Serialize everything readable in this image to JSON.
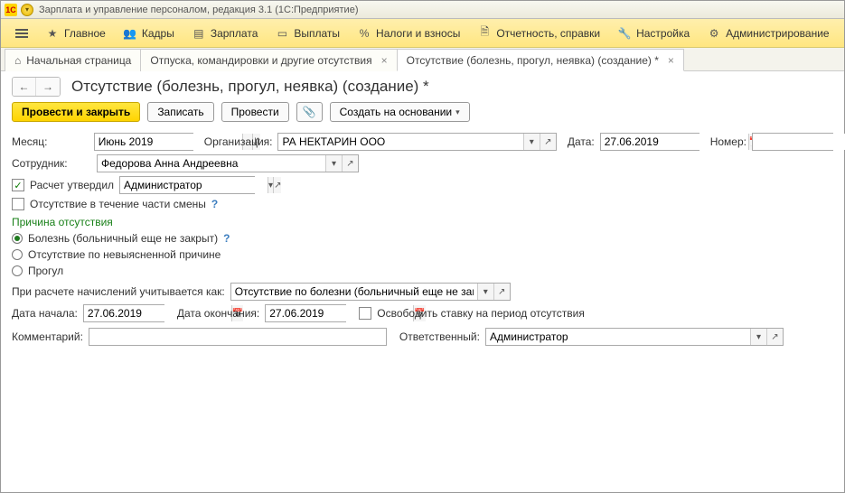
{
  "titlebar": {
    "logo_text": "1С",
    "title": "Зарплата и управление персоналом, редакция 3.1  (1С:Предприятие)"
  },
  "menu": {
    "main": "Главное",
    "staff": "Кадры",
    "salary": "Зарплата",
    "payments": "Выплаты",
    "taxes": "Налоги и взносы",
    "reports": "Отчетность, справки",
    "settings": "Настройка",
    "admin": "Администрирование"
  },
  "tabs": {
    "home": "Начальная страница",
    "t1": "Отпуска, командировки и другие отсутствия",
    "t2": "Отсутствие (болезнь, прогул, неявка) (создание) *"
  },
  "page": {
    "title": "Отсутствие (болезнь, прогул, неявка) (создание) *"
  },
  "actions": {
    "post_close": "Провести и закрыть",
    "save": "Записать",
    "post": "Провести",
    "create_based": "Создать на основании"
  },
  "form": {
    "month_lbl": "Месяц:",
    "month_val": "Июнь 2019",
    "org_lbl": "Организация:",
    "org_val": "РА НЕКТАРИН ООО",
    "date_lbl": "Дата:",
    "date_val": "27.06.2019",
    "number_lbl": "Номер:",
    "number_val": "",
    "employee_lbl": "Сотрудник:",
    "employee_val": "Федорова Анна Андреевна",
    "approved_lbl": "Расчет утвердил",
    "approved_val": "Администратор",
    "partial_lbl": "Отсутствие в течение части смены",
    "reason_section": "Причина отсутствия",
    "r1": "Болезнь (больничный еще не закрыт)",
    "r2": "Отсутствие по невыясненной причине",
    "r3": "Прогул",
    "calc_lbl": "При расчете начислений учитывается как:",
    "calc_val": "Отсутствие по болезни (больничный еще не закрыт)",
    "start_lbl": "Дата начала:",
    "start_val": "27.06.2019",
    "end_lbl": "Дата окончания:",
    "end_val": "27.06.2019",
    "release_lbl": "Освободить ставку на период отсутствия",
    "comment_lbl": "Комментарий:",
    "comment_val": "",
    "resp_lbl": "Ответственный:",
    "resp_val": "Администратор"
  },
  "glyph": {
    "question": "?",
    "check": "✓",
    "dots": "⋯",
    "cal": "📅",
    "open": "↗",
    "dd": "▾",
    "left": "←",
    "right": "→",
    "updown": "⇵",
    "clip": "📎",
    "star": "★",
    "percent": "%",
    "wrench": "🔧",
    "gear": "⚙",
    "doc": "▤",
    "wallet": "▭",
    "people": "👥",
    "report": "🗎"
  }
}
